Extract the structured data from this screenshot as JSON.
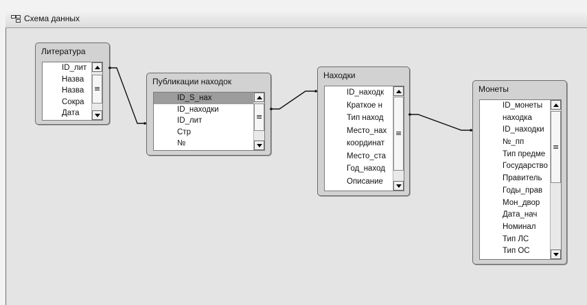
{
  "window": {
    "title": "Схема данных",
    "icon": "relationships-icon"
  },
  "tables": {
    "literatura": {
      "name": "Литература",
      "fields": [
        "ID_лит",
        "Назва",
        "Назва",
        "Сокра",
        "Дата"
      ]
    },
    "publikacii": {
      "name": "Публикации находок",
      "fields": [
        "ID_S_нах",
        "ID_находки",
        "ID_лит",
        "Стр",
        "№"
      ],
      "selected_index": 0
    },
    "nahodki": {
      "name": "Находки",
      "fields": [
        "ID_находк",
        "Краткое н",
        "Тип наход",
        "Место_нах",
        "координат",
        "Место_ста",
        "Год_наход",
        "Описание"
      ]
    },
    "monety": {
      "name": "Монеты",
      "fields": [
        "ID_монеты",
        "находка",
        "ID_находки",
        "№_пп",
        "Тип предме",
        "Государство",
        "Правитель",
        "Годы_прав",
        "Мон_двор",
        "Дата_нач",
        "Номинал",
        "Тип ЛС",
        "Тип ОС"
      ]
    }
  }
}
